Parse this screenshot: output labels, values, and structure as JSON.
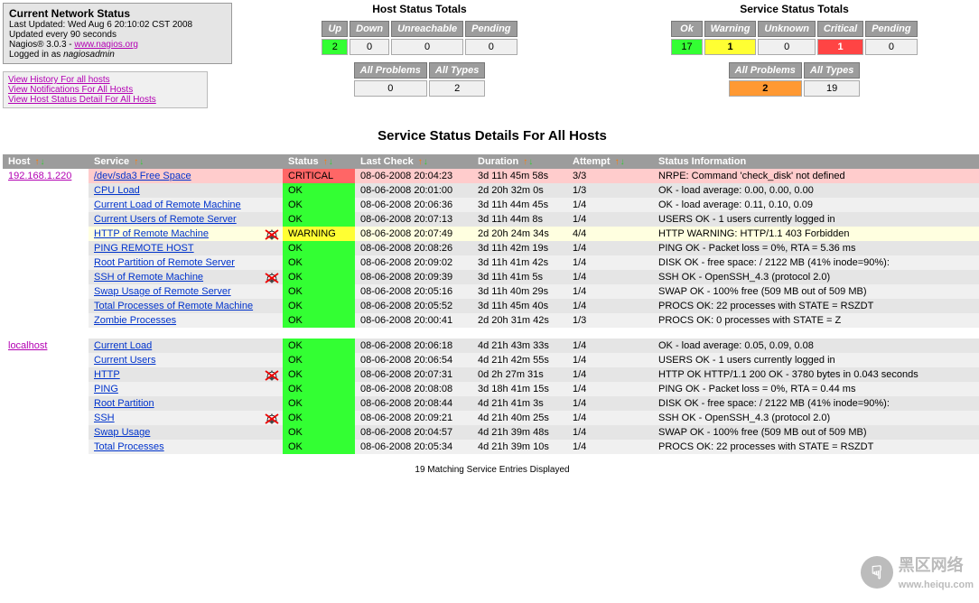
{
  "info": {
    "title": "Current Network Status",
    "last_updated": "Last Updated: Wed Aug 6 20:10:02 CST 2008",
    "update_every": "Updated every 90 seconds",
    "version_prefix": "Nagios® 3.0.3 - ",
    "version_link": "www.nagios.org",
    "logged_in_prefix": "Logged in as ",
    "logged_in_user": "nagiosadmin"
  },
  "info_links": {
    "history": "View History For all hosts",
    "notifications": "View Notifications For All Hosts",
    "host_status": "View Host Status Detail For All Hosts"
  },
  "host_totals": {
    "title": "Host Status Totals",
    "headers": {
      "up": "Up",
      "down": "Down",
      "unreachable": "Unreachable",
      "pending": "Pending"
    },
    "up": "2",
    "down": "0",
    "unreachable": "0",
    "pending": "0",
    "allprob_h": "All Problems",
    "alltypes_h": "All Types",
    "allprob": "0",
    "alltypes": "2"
  },
  "service_totals": {
    "title": "Service Status Totals",
    "headers": {
      "ok": "Ok",
      "warning": "Warning",
      "unknown": "Unknown",
      "critical": "Critical",
      "pending": "Pending"
    },
    "ok": "17",
    "warning": "1",
    "unknown": "0",
    "critical": "1",
    "pending": "0",
    "allprob_h": "All Problems",
    "alltypes_h": "All Types",
    "allprob": "2",
    "alltypes": "19"
  },
  "main_title": "Service Status Details For All Hosts",
  "columns": {
    "host": "Host",
    "service": "Service",
    "status": "Status",
    "last_check": "Last Check",
    "duration": "Duration",
    "attempt": "Attempt",
    "info": "Status Information"
  },
  "hosts": [
    "192.168.1.220",
    "localhost"
  ],
  "rows": [
    {
      "host_row": true,
      "host": "192.168.1.220",
      "service": "/dev/sda3 Free Space",
      "bell": false,
      "status": "CRITICAL",
      "st_cls": "st-critical",
      "row_cls": "row-crit",
      "last": "08-06-2008 20:04:23",
      "dur": "3d 11h 45m 58s",
      "att": "3/3",
      "info": "NRPE: Command 'check_disk' not defined"
    },
    {
      "service": "CPU Load",
      "bell": false,
      "status": "OK",
      "st_cls": "st-ok",
      "row_cls": "row-even",
      "last": "08-06-2008 20:01:00",
      "dur": "2d 20h 32m 0s",
      "att": "1/3",
      "info": "OK - load average: 0.00, 0.00, 0.00"
    },
    {
      "service": "Current Load of Remote Machine",
      "bell": false,
      "status": "OK",
      "st_cls": "st-ok",
      "row_cls": "row-odd",
      "last": "08-06-2008 20:06:36",
      "dur": "3d 11h 44m 45s",
      "att": "1/4",
      "info": "OK - load average: 0.11, 0.10, 0.09"
    },
    {
      "service": "Current Users of Remote Server",
      "bell": false,
      "status": "OK",
      "st_cls": "st-ok",
      "row_cls": "row-even",
      "last": "08-06-2008 20:07:13",
      "dur": "3d 11h 44m 8s",
      "att": "1/4",
      "info": "USERS OK - 1 users currently logged in"
    },
    {
      "service": "HTTP of Remote Machine",
      "bell": true,
      "status": "WARNING",
      "st_cls": "st-warning",
      "row_cls": "row-warn",
      "last": "08-06-2008 20:07:49",
      "dur": "2d 20h 24m 34s",
      "att": "4/4",
      "info": "HTTP WARNING: HTTP/1.1 403 Forbidden"
    },
    {
      "service": "PING REMOTE HOST",
      "bell": false,
      "status": "OK",
      "st_cls": "st-ok",
      "row_cls": "row-even",
      "last": "08-06-2008 20:08:26",
      "dur": "3d 11h 42m 19s",
      "att": "1/4",
      "info": "PING OK - Packet loss = 0%, RTA = 5.36 ms"
    },
    {
      "service": "Root Partition of Remote Server",
      "bell": false,
      "status": "OK",
      "st_cls": "st-ok",
      "row_cls": "row-odd",
      "last": "08-06-2008 20:09:02",
      "dur": "3d 11h 41m 42s",
      "att": "1/4",
      "info": "DISK OK - free space: / 2122 MB (41% inode=90%):"
    },
    {
      "service": "SSH of Remote Machine",
      "bell": true,
      "status": "OK",
      "st_cls": "st-ok",
      "row_cls": "row-even",
      "last": "08-06-2008 20:09:39",
      "dur": "3d 11h 41m 5s",
      "att": "1/4",
      "info": "SSH OK - OpenSSH_4.3 (protocol 2.0)"
    },
    {
      "service": "Swap Usage of Remote Server",
      "bell": false,
      "status": "OK",
      "st_cls": "st-ok",
      "row_cls": "row-odd",
      "last": "08-06-2008 20:05:16",
      "dur": "3d 11h 40m 29s",
      "att": "1/4",
      "info": "SWAP OK - 100% free (509 MB out of 509 MB)"
    },
    {
      "service": "Total Processes of Remote Machine",
      "bell": false,
      "status": "OK",
      "st_cls": "st-ok",
      "row_cls": "row-even",
      "last": "08-06-2008 20:05:52",
      "dur": "3d 11h 45m 40s",
      "att": "1/4",
      "info": "PROCS OK: 22 processes with STATE = RSZDT"
    },
    {
      "service": "Zombie Processes",
      "bell": false,
      "status": "OK",
      "st_cls": "st-ok",
      "row_cls": "row-odd",
      "last": "08-06-2008 20:00:41",
      "dur": "2d 20h 31m 42s",
      "att": "1/3",
      "info": "PROCS OK: 0 processes with STATE = Z"
    },
    {
      "spacer": true
    },
    {
      "host_row": true,
      "host": "localhost",
      "service": "Current Load",
      "bell": false,
      "status": "OK",
      "st_cls": "st-ok",
      "row_cls": "row-even",
      "last": "08-06-2008 20:06:18",
      "dur": "4d 21h 43m 33s",
      "att": "1/4",
      "info": "OK - load average: 0.05, 0.09, 0.08"
    },
    {
      "service": "Current Users",
      "bell": false,
      "status": "OK",
      "st_cls": "st-ok",
      "row_cls": "row-odd",
      "last": "08-06-2008 20:06:54",
      "dur": "4d 21h 42m 55s",
      "att": "1/4",
      "info": "USERS OK - 1 users currently logged in"
    },
    {
      "service": "HTTP",
      "bell": true,
      "status": "OK",
      "st_cls": "st-ok",
      "row_cls": "row-even",
      "last": "08-06-2008 20:07:31",
      "dur": "0d 2h 27m 31s",
      "att": "1/4",
      "info": "HTTP OK HTTP/1.1 200 OK - 3780 bytes in 0.043 seconds"
    },
    {
      "service": "PING",
      "bell": false,
      "status": "OK",
      "st_cls": "st-ok",
      "row_cls": "row-odd",
      "last": "08-06-2008 20:08:08",
      "dur": "3d 18h 41m 15s",
      "att": "1/4",
      "info": "PING OK - Packet loss = 0%, RTA = 0.44 ms"
    },
    {
      "service": "Root Partition",
      "bell": false,
      "status": "OK",
      "st_cls": "st-ok",
      "row_cls": "row-even",
      "last": "08-06-2008 20:08:44",
      "dur": "4d 21h 41m 3s",
      "att": "1/4",
      "info": "DISK OK - free space: / 2122 MB (41% inode=90%):"
    },
    {
      "service": "SSH",
      "bell": true,
      "status": "OK",
      "st_cls": "st-ok",
      "row_cls": "row-odd",
      "last": "08-06-2008 20:09:21",
      "dur": "4d 21h 40m 25s",
      "att": "1/4",
      "info": "SSH OK - OpenSSH_4.3 (protocol 2.0)"
    },
    {
      "service": "Swap Usage",
      "bell": false,
      "status": "OK",
      "st_cls": "st-ok",
      "row_cls": "row-even",
      "last": "08-06-2008 20:04:57",
      "dur": "4d 21h 39m 48s",
      "att": "1/4",
      "info": "SWAP OK - 100% free (509 MB out of 509 MB)"
    },
    {
      "service": "Total Processes",
      "bell": false,
      "status": "OK",
      "st_cls": "st-ok",
      "row_cls": "row-odd",
      "last": "08-06-2008 20:05:34",
      "dur": "4d 21h 39m 10s",
      "att": "1/4",
      "info": "PROCS OK: 22 processes with STATE = RSZDT"
    }
  ],
  "footer": "19 Matching Service Entries Displayed",
  "watermark": {
    "text": "黑区网络",
    "url": "www.heiqu.com"
  }
}
